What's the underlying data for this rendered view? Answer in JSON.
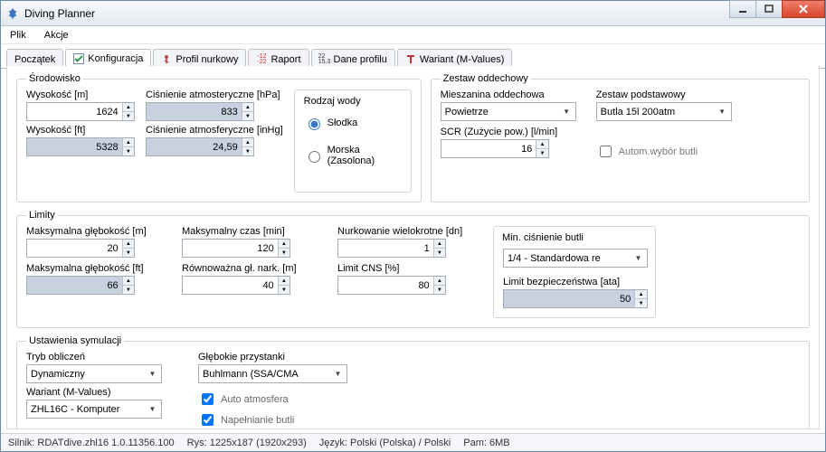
{
  "title": "Diving Planner",
  "menu": {
    "plik": "Plik",
    "akcje": "Akcje"
  },
  "tabs": {
    "poczatek": "Początek",
    "konfiguracja": "Konfiguracja",
    "profil": "Profil nurkowy",
    "raport": "Raport",
    "dane": "Dane profilu",
    "wariant": "Wariant (M-Values)"
  },
  "env": {
    "legend": "Środowisko",
    "wysokosc_m_label": "Wysokość [m]",
    "wysokosc_m": "1624",
    "cisn_hpa_label": "Ciśnienie atmosteryczne [hPa]",
    "cisn_hpa": "833",
    "wysokosc_ft_label": "Wysokość [ft]",
    "wysokosc_ft": "5328",
    "cisn_inhg_label": "Ciśnienie atmosferyczne [inHg]",
    "cisn_inhg": "24,59",
    "rodzaj_wody": "Rodzaj wody",
    "slodka": "Słodka",
    "morska": "Morska (Zasolona)"
  },
  "breath": {
    "legend": "Zestaw oddechowy",
    "mieszanina_label": "Mieszanina oddechowa",
    "mieszanina": "Powietrze",
    "zestaw_label": "Zestaw podstawowy",
    "zestaw": "Butla 15l 200atm",
    "scr_label": "SCR (Zużycie pow.) [l/min]",
    "scr": "16",
    "autom": "Autom.wybór butli"
  },
  "lim": {
    "legend": "Limity",
    "gl_m_label": "Maksymalna głębokość [m]",
    "gl_m": "20",
    "czas_label": "Maksymalny czas [min]",
    "czas": "120",
    "wielo_label": "Nurkowanie wielokrotne [dn]",
    "wielo": "1",
    "gl_ft_label": "Maksymalna głębokość [ft]",
    "gl_ft": "66",
    "nark_label": "Równoważna gł. nark. [m]",
    "nark": "40",
    "cns_label": "Limit CNS [%]",
    "cns": "80",
    "minpress_legend": "Min. ciśnienie butli",
    "minpress": "1/4 - Standardowa re",
    "bezp_label": "Limit bezpieczeństwa [ata]",
    "bezp": "50"
  },
  "sim": {
    "legend": "Ustawienia symulacji",
    "tryb_label": "Tryb obliczeń",
    "tryb": "Dynamiczny",
    "przyst_label": "Głębokie przystanki",
    "przyst": "Buhlmann (SSA/CMA",
    "wariant_label": "Wariant (M-Values)",
    "wariant": "ZHL16C - Komputer",
    "auto_atm": "Auto atmosfera",
    "napeln": "Napełnianie butli"
  },
  "status": {
    "silnik": "Silnik: RDATdive.zhl16 1.0.11356.100",
    "rys": "Rys: 1225x187 (1920x293)",
    "jezyk": "Język: Polski (Polska) / Polski",
    "pam": "Pam: 6MB"
  }
}
